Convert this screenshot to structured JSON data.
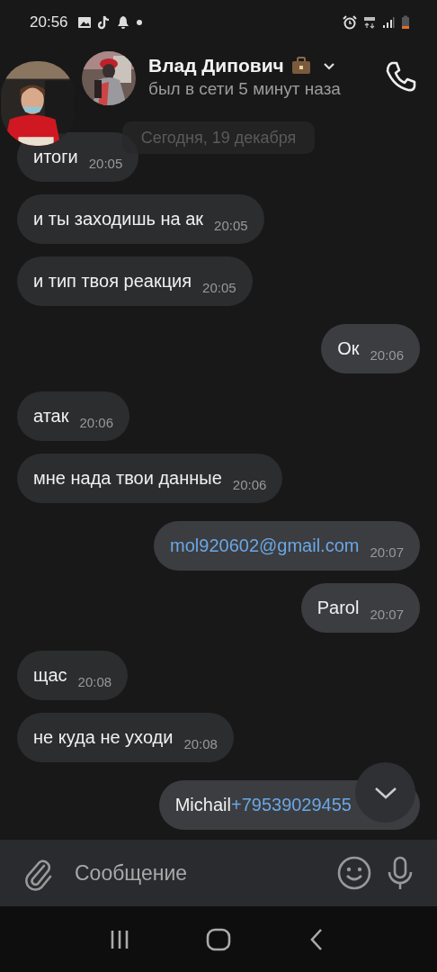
{
  "status_bar": {
    "time": "20:56"
  },
  "header": {
    "name": "Влад Дипович",
    "status": "был в сети 5 минут наза"
  },
  "date_chip": "Сегодня, 19 декабря",
  "messages": [
    {
      "outgoing": false,
      "parts": [
        {
          "kind": "text",
          "text": "итоги"
        }
      ],
      "time": "20:05"
    },
    {
      "outgoing": false,
      "parts": [
        {
          "kind": "text",
          "text": "и ты заходишь на ак"
        }
      ],
      "time": "20:05"
    },
    {
      "outgoing": false,
      "parts": [
        {
          "kind": "text",
          "text": "и тип твоя реакция"
        }
      ],
      "time": "20:05"
    },
    {
      "outgoing": true,
      "parts": [
        {
          "kind": "text",
          "text": "Ок"
        }
      ],
      "time": "20:06"
    },
    {
      "outgoing": false,
      "parts": [
        {
          "kind": "text",
          "text": "атак"
        }
      ],
      "time": "20:06"
    },
    {
      "outgoing": false,
      "parts": [
        {
          "kind": "text",
          "text": "мне нада твои данные"
        }
      ],
      "time": "20:06"
    },
    {
      "outgoing": true,
      "parts": [
        {
          "kind": "link",
          "text": "mol920602@gmail.com"
        }
      ],
      "time": "20:07"
    },
    {
      "outgoing": true,
      "parts": [
        {
          "kind": "text",
          "text": "Parol"
        }
      ],
      "time": "20:07"
    },
    {
      "outgoing": false,
      "parts": [
        {
          "kind": "text",
          "text": "щас"
        }
      ],
      "time": "20:08"
    },
    {
      "outgoing": false,
      "parts": [
        {
          "kind": "text",
          "text": "не куда не уходи"
        }
      ],
      "time": "20:08"
    },
    {
      "outgoing": true,
      "parts": [
        {
          "kind": "text",
          "text": "Michail"
        },
        {
          "kind": "link",
          "text": "+79539029455"
        }
      ]
    }
  ],
  "composer": {
    "placeholder": "Сообщение"
  }
}
